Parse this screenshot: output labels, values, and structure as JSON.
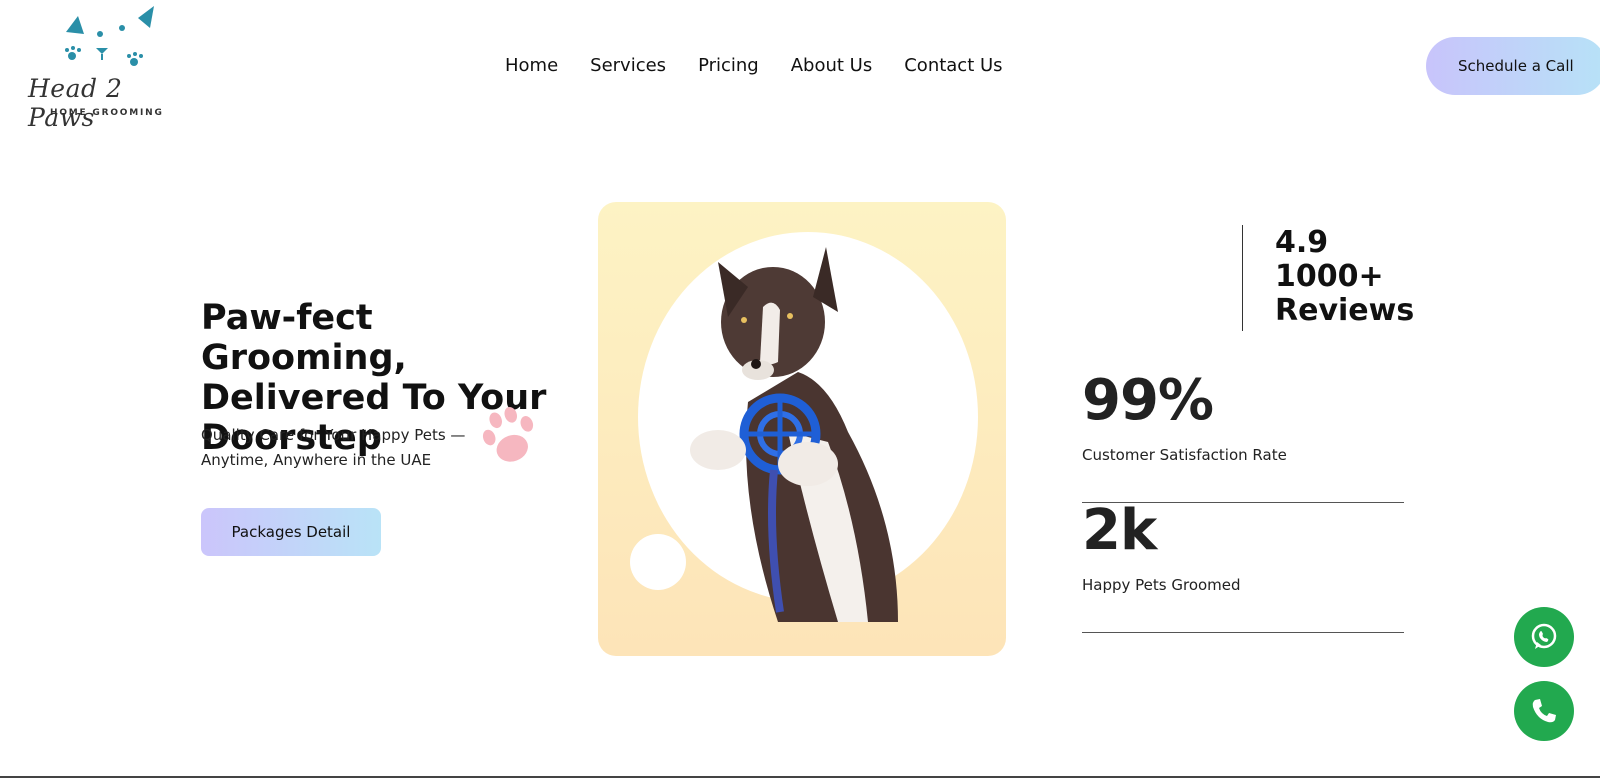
{
  "brand": {
    "name": "Head 2 Paws",
    "tagline": "HOME GROOMING",
    "color": "#2a8fa8"
  },
  "nav": {
    "items": [
      "Home",
      "Services",
      "Pricing",
      "About Us",
      "Contact Us"
    ]
  },
  "header": {
    "cta_label": "Schedule a Call"
  },
  "hero": {
    "title": "Paw-fect Grooming, Delivered To Your Doorstep",
    "subtitle": "Quality Care for Your Happy Pets — Anytime, Anywhere in the UAE",
    "button_label": "Packages Detail",
    "image_icon": "dog-with-ball-photo"
  },
  "stats": {
    "rating_value": "4.9",
    "rating_reviews": "1000+",
    "rating_reviews_label": "Reviews",
    "satisfaction_value": "99%",
    "satisfaction_label": "Customer Satisfaction Rate",
    "pets_value": "2k",
    "pets_label": "Happy Pets Groomed"
  },
  "floating": {
    "whatsapp_icon": "whatsapp-icon",
    "phone_icon": "phone-icon",
    "color": "#22a94f"
  }
}
